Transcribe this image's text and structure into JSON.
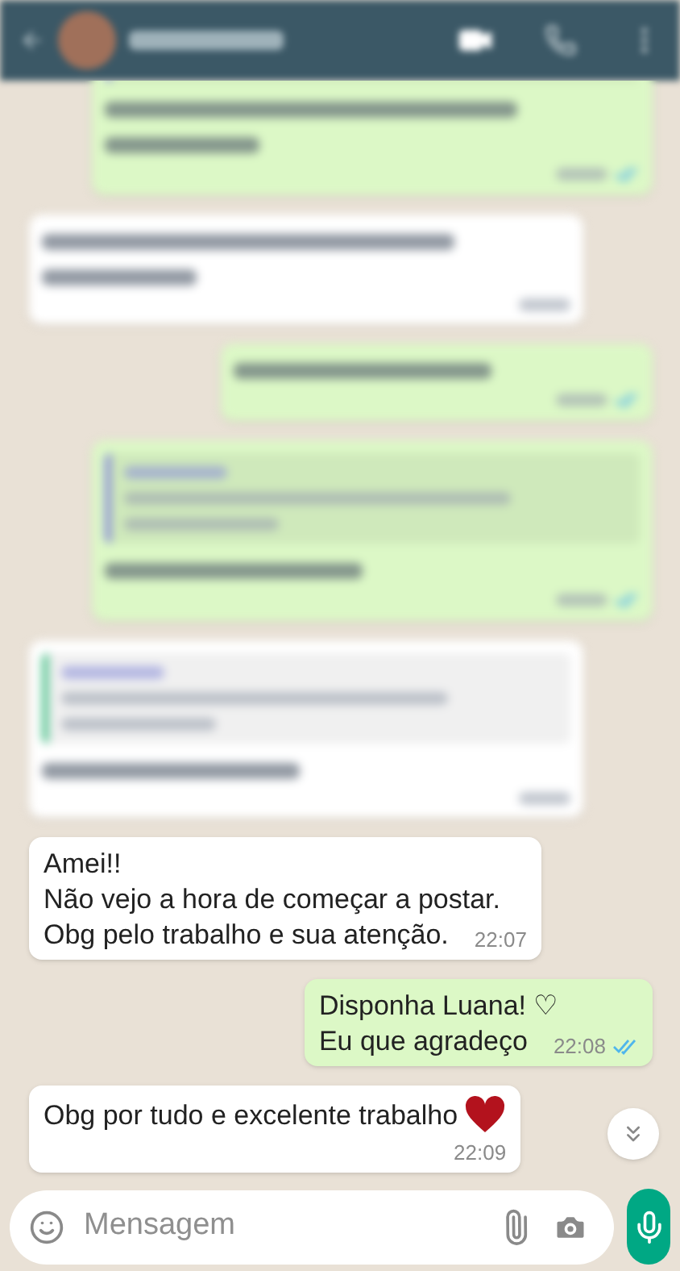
{
  "messages": [
    {
      "kind": "blurred",
      "outgoing": true,
      "quoted": true,
      "long": true,
      "read": true
    },
    {
      "kind": "blurred",
      "outgoing": false,
      "quoted": false,
      "long": true
    },
    {
      "kind": "blurred",
      "outgoing": true,
      "quoted": false,
      "long": false,
      "read": true
    },
    {
      "kind": "blurred",
      "outgoing": true,
      "quoted": true,
      "long": false,
      "read": true
    },
    {
      "kind": "blurred",
      "outgoing": false,
      "quoted": true,
      "long": false
    },
    {
      "kind": "text",
      "outgoing": false,
      "lines": [
        "Amei!!",
        "Não vejo a hora de começar a postar.",
        "Obg pelo trabalho e sua atenção."
      ],
      "time": "22:07"
    },
    {
      "kind": "text",
      "outgoing": true,
      "lines": [
        "Disponha Luana! ♡",
        "Eu que agradeço"
      ],
      "time": "22:08",
      "read": true
    },
    {
      "kind": "text",
      "outgoing": false,
      "lines": [
        "Obg por tudo e excelente trabalho"
      ],
      "heart": true,
      "time": "22:09"
    }
  ],
  "input": {
    "placeholder": "Mensagem"
  }
}
